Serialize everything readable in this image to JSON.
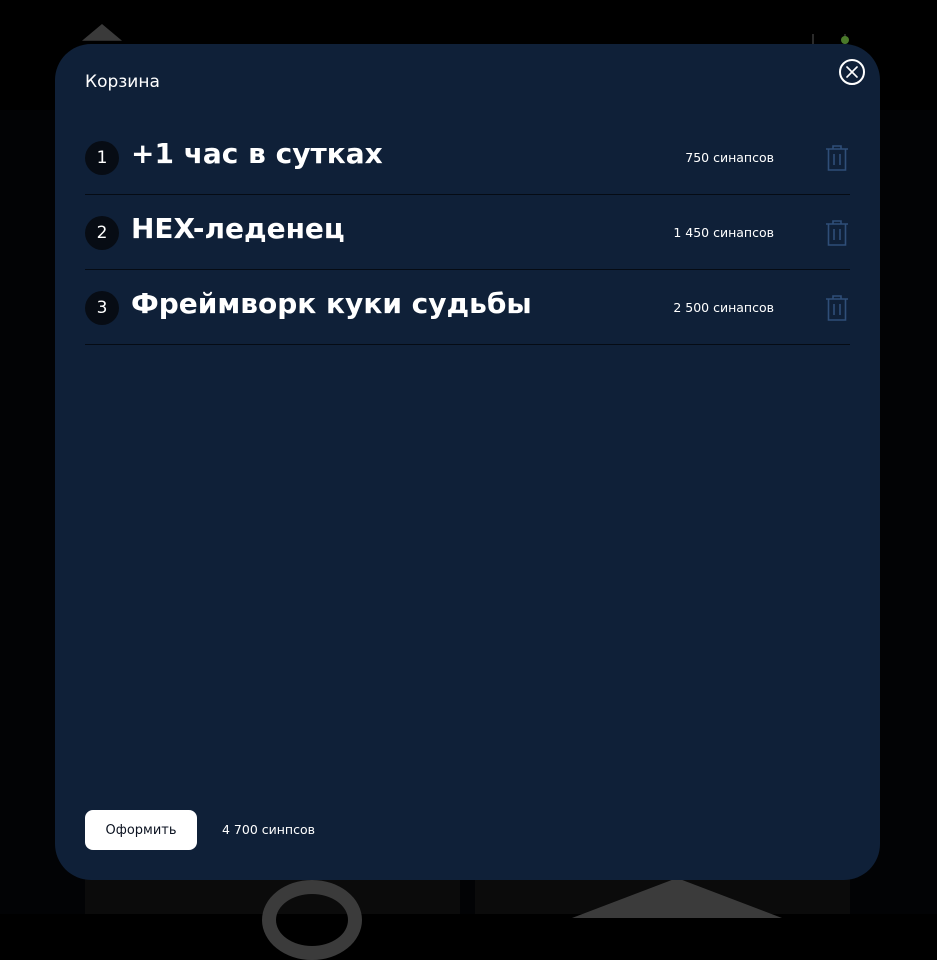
{
  "modal": {
    "title": "Корзина",
    "close_icon": "close-icon"
  },
  "cart": {
    "items": [
      {
        "index": "1",
        "name": "+1 час в сутках",
        "price": "750 синапсов",
        "delete_icon": "trash-icon"
      },
      {
        "index": "2",
        "name": "HEX-леденец",
        "price": "1 450 синапсов",
        "delete_icon": "trash-icon"
      },
      {
        "index": "3",
        "name": "Фреймворк куки судьбы",
        "price": "2 500 синапсов",
        "delete_icon": "trash-icon"
      }
    ]
  },
  "footer": {
    "checkout_label": "Оформить",
    "total": "4 700 синпсов"
  },
  "colors": {
    "modal_bg": "#0f2038",
    "page_bg": "#000000",
    "trash_icon": "#2f4e78",
    "button_bg": "#ffffff"
  }
}
